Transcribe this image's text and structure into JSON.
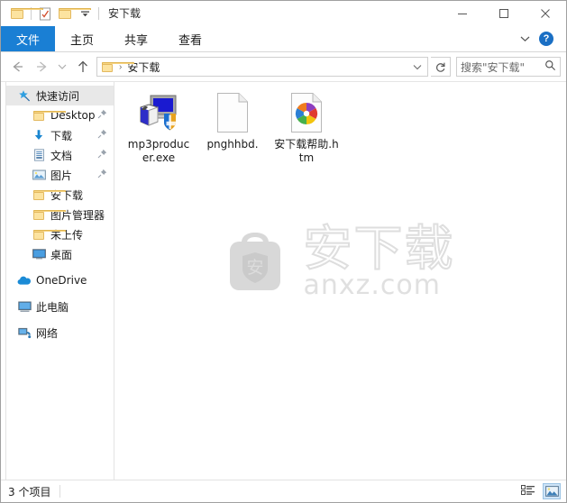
{
  "window": {
    "title": "安下载",
    "quick_access": [
      {
        "name": "folder-icon",
        "label": "文件夹"
      },
      {
        "name": "properties-icon",
        "label": "属性"
      },
      {
        "name": "new-folder-icon",
        "label": "新建文件夹"
      },
      {
        "name": "customize-dropdown-icon",
        "label": "自定义快速访问工具栏"
      }
    ],
    "controls": {
      "minimize": "最小化",
      "maximize": "最大化",
      "close": "关闭"
    }
  },
  "ribbon": {
    "tabs": [
      {
        "label": "文件",
        "active": true
      },
      {
        "label": "主页",
        "active": false
      },
      {
        "label": "共享",
        "active": false
      },
      {
        "label": "查看",
        "active": false
      }
    ],
    "collapse_label": "展开功能区",
    "help_label": "?"
  },
  "nav": {
    "back_label": "后退",
    "forward_label": "前进",
    "recent_label": "最近浏览的位置",
    "up_label": "上移一级",
    "breadcrumb": [
      {
        "label": "安下载"
      }
    ],
    "breadcrumb_separator": "›",
    "address_dropdown_label": "以前的位置",
    "refresh_label": "刷新",
    "search": {
      "placeholder": "搜索\"安下载\"",
      "value": ""
    }
  },
  "sidebar": {
    "items": [
      {
        "label": "快速访问",
        "icon": "star-pin-icon",
        "level": 0,
        "selected": true,
        "pinned": false,
        "gap": false
      },
      {
        "label": "Desktop",
        "icon": "folder-icon",
        "level": 1,
        "selected": false,
        "pinned": true,
        "gap": false
      },
      {
        "label": "下载",
        "icon": "download-icon",
        "level": 1,
        "selected": false,
        "pinned": true,
        "gap": false
      },
      {
        "label": "文档",
        "icon": "document-icon",
        "level": 1,
        "selected": false,
        "pinned": true,
        "gap": false
      },
      {
        "label": "图片",
        "icon": "pictures-icon",
        "level": 1,
        "selected": false,
        "pinned": true,
        "gap": false
      },
      {
        "label": "安下载",
        "icon": "folder-icon",
        "level": 1,
        "selected": false,
        "pinned": false,
        "gap": false
      },
      {
        "label": "图片管理器",
        "icon": "folder-icon",
        "level": 1,
        "selected": false,
        "pinned": false,
        "gap": false
      },
      {
        "label": "未上传",
        "icon": "folder-icon",
        "level": 1,
        "selected": false,
        "pinned": false,
        "gap": false
      },
      {
        "label": "桌面",
        "icon": "desktop-icon",
        "level": 1,
        "selected": false,
        "pinned": false,
        "gap": false
      },
      {
        "label": "OneDrive",
        "icon": "onedrive-icon",
        "level": 0,
        "selected": false,
        "pinned": false,
        "gap": true
      },
      {
        "label": "此电脑",
        "icon": "this-pc-icon",
        "level": 0,
        "selected": false,
        "pinned": false,
        "gap": true
      },
      {
        "label": "网络",
        "icon": "network-icon",
        "level": 0,
        "selected": false,
        "pinned": false,
        "gap": true
      }
    ]
  },
  "files": [
    {
      "name": "mp3producer.exe",
      "icon": "installer-icon"
    },
    {
      "name": "pnghhbd.",
      "icon": "blank-document-icon"
    },
    {
      "name": "安下载帮助.htm",
      "icon": "browser-document-icon"
    }
  ],
  "watermark": {
    "brand": "安下载",
    "domain": "anxz.com",
    "shield_char": "安"
  },
  "status": {
    "item_count": "3 个项目",
    "views": [
      {
        "name": "details-view-button",
        "label": "详细信息",
        "selected": false
      },
      {
        "name": "large-icons-view-button",
        "label": "大图标",
        "selected": true
      }
    ]
  },
  "colors": {
    "accent": "#1a7fd4",
    "folder": "#fce3a0",
    "selection": "#cde3f7"
  }
}
